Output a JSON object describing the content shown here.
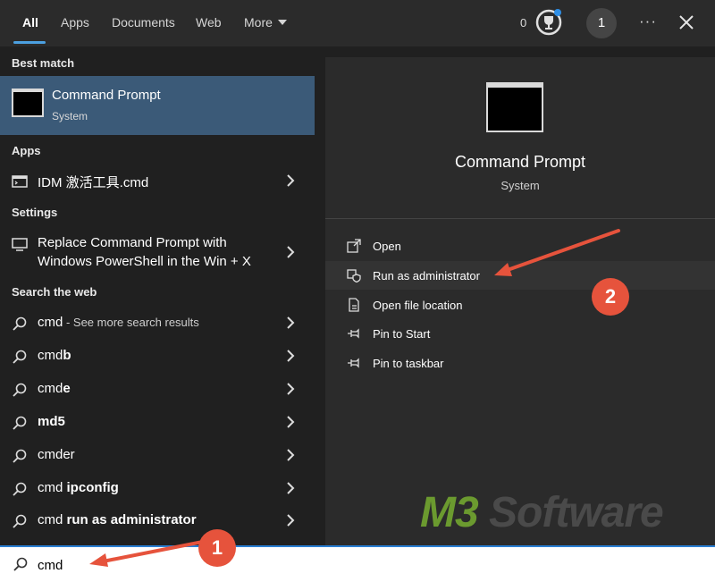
{
  "tabs": [
    "All",
    "Apps",
    "Documents",
    "Web",
    "More"
  ],
  "header": {
    "reward_count": "0",
    "avatar_letter": "1",
    "more_dots": "···"
  },
  "left": {
    "best_match_label": "Best match",
    "best": {
      "title": "Command Prompt",
      "subtitle": "System"
    },
    "apps_label": "Apps",
    "app_item": "IDM 激活工具.cmd",
    "settings_label": "Settings",
    "setting_line1": "Replace Command Prompt with",
    "setting_line2": "Windows PowerShell in the Win + X",
    "web_label": "Search the web",
    "web_first": {
      "term": "cmd",
      "suffix": " - See more search results"
    },
    "web_items": [
      {
        "plain": "cmd",
        "bold": "b"
      },
      {
        "plain": "cmd",
        "bold": "e"
      },
      {
        "plain": "",
        "bold": "md5"
      },
      {
        "plain": "cmder",
        "bold": ""
      },
      {
        "plain": "cmd ",
        "bold": "ipconfig"
      },
      {
        "plain": "cmd ",
        "bold": "run as administrator"
      }
    ]
  },
  "right": {
    "title": "Command Prompt",
    "subtitle": "System",
    "actions": [
      "Open",
      "Run as administrator",
      "Open file location",
      "Pin to Start",
      "Pin to taskbar"
    ]
  },
  "search": {
    "value": "cmd"
  },
  "annotations": {
    "badge1": "1",
    "badge2": "2",
    "color": "#e6533c"
  },
  "watermark": {
    "part1": "M3",
    "part2": " Software"
  }
}
